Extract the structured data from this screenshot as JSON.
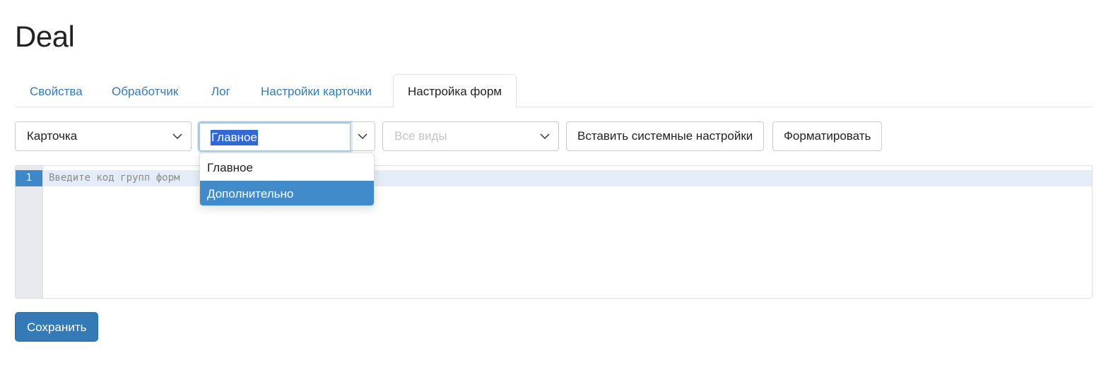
{
  "page": {
    "title": "Deal"
  },
  "tabs": [
    {
      "label": "Свойства"
    },
    {
      "label": "Обработчик"
    },
    {
      "label": "Лог"
    },
    {
      "label": "Настройки карточки"
    },
    {
      "label": "Настройка форм",
      "active": true
    }
  ],
  "toolbar": {
    "type_select": {
      "value": "Карточка"
    },
    "group_combo": {
      "value": "Главное",
      "text_selected": true
    },
    "view_select": {
      "placeholder": "Все виды"
    },
    "insert_button": "Вставить системные настройки",
    "format_button": "Форматировать"
  },
  "dropdown": {
    "options": [
      {
        "label": "Главное"
      },
      {
        "label": "Дополнительно",
        "highlighted": true
      }
    ]
  },
  "editor": {
    "line_number": "1",
    "placeholder": "Введите код групп форм"
  },
  "footer": {
    "save_button": "Сохранить"
  },
  "colors": {
    "link": "#337ab7",
    "primary": "#337ab7",
    "highlight": "#428bca",
    "selection": "#3367d6"
  },
  "icons": [
    "chevron-down-icon"
  ]
}
